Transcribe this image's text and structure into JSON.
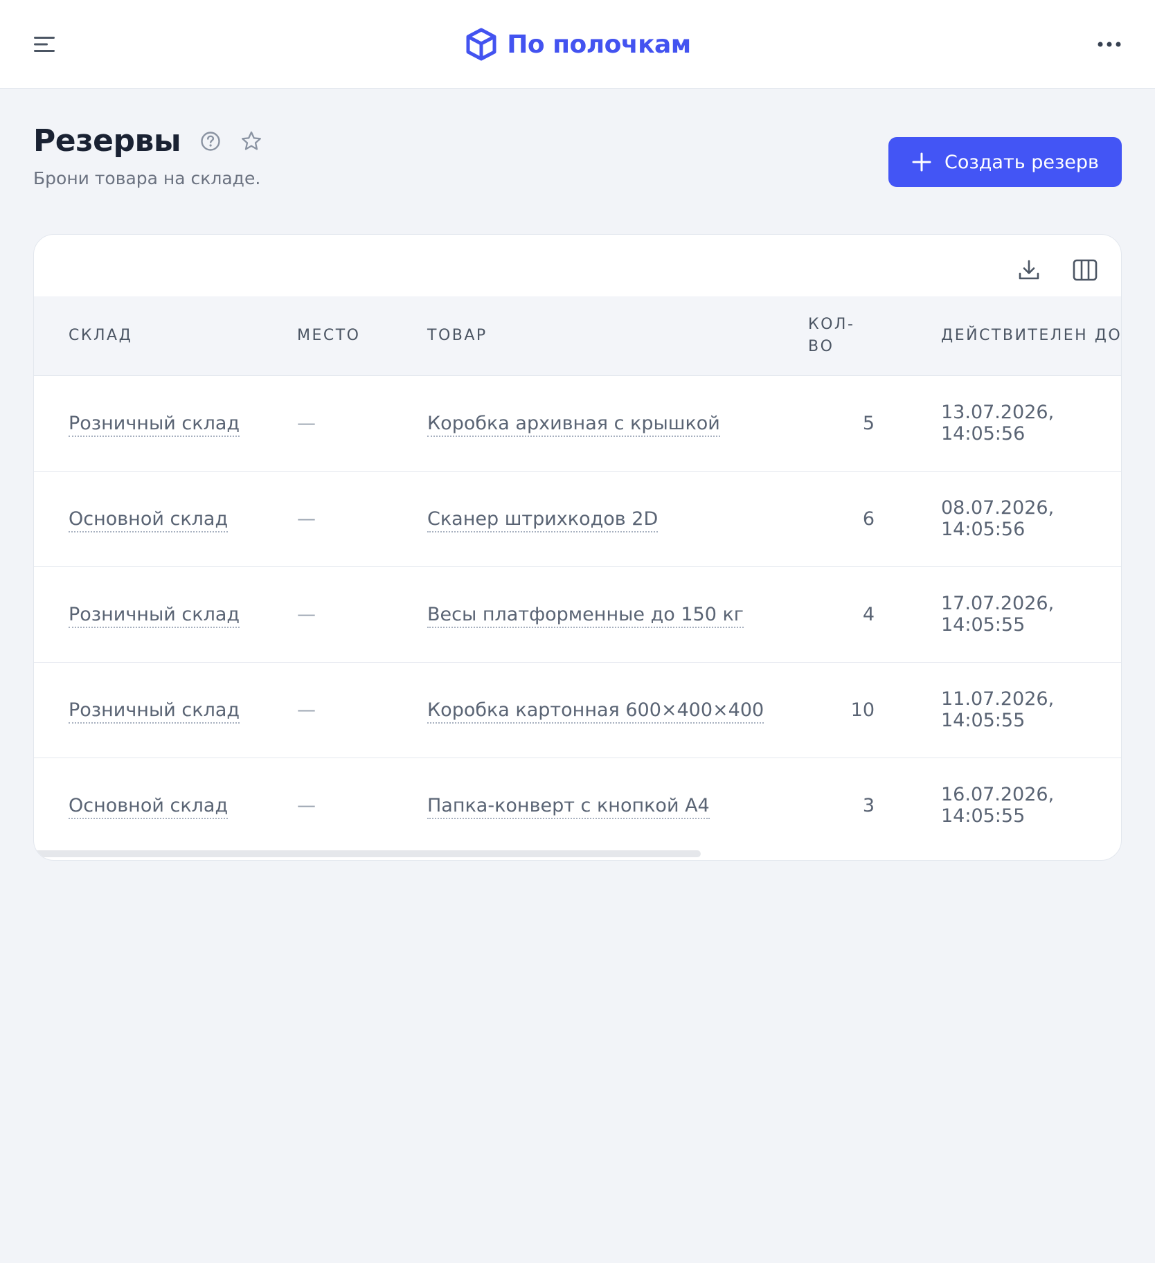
{
  "header": {
    "menu_icon": "hamburger-menu-icon",
    "logo_icon": "cube-icon",
    "brand": "По полочкам",
    "more_icon": "more-horizontal-icon",
    "brand_color": "#4353f0"
  },
  "page": {
    "title": "Резервы",
    "subtitle": "Брони товара на складе.",
    "help_icon": "help-circle-icon",
    "favorite_icon": "star-icon",
    "create_button": "Создать резерв",
    "accent_color": "#4355f5"
  },
  "toolbar": {
    "download_icon": "download-icon",
    "columns_icon": "columns-icon"
  },
  "table": {
    "columns": [
      "СКЛАД",
      "МЕСТО",
      "ТОВАР",
      "КОЛ-ВО",
      "ДЕЙСТВИТЕЛЕН ДО"
    ],
    "rows": [
      {
        "warehouse": "Розничный склад",
        "place": "—",
        "product": "Коробка архивная с крышкой",
        "qty": "5",
        "valid_until": "13.07.2026, 14:05:56"
      },
      {
        "warehouse": "Основной склад",
        "place": "—",
        "product": "Сканер штрихкодов 2D",
        "qty": "6",
        "valid_until": "08.07.2026, 14:05:56"
      },
      {
        "warehouse": "Розничный склад",
        "place": "—",
        "product": "Весы платформенные до 150 кг",
        "qty": "4",
        "valid_until": "17.07.2026, 14:05:55"
      },
      {
        "warehouse": "Розничный склад",
        "place": "—",
        "product": "Коробка картонная 600×400×400",
        "qty": "10",
        "valid_until": "11.07.2026, 14:05:55"
      },
      {
        "warehouse": "Основной склад",
        "place": "—",
        "product": "Папка-конверт с кнопкой А4",
        "qty": "3",
        "valid_until": "16.07.2026, 14:05:55"
      }
    ]
  }
}
